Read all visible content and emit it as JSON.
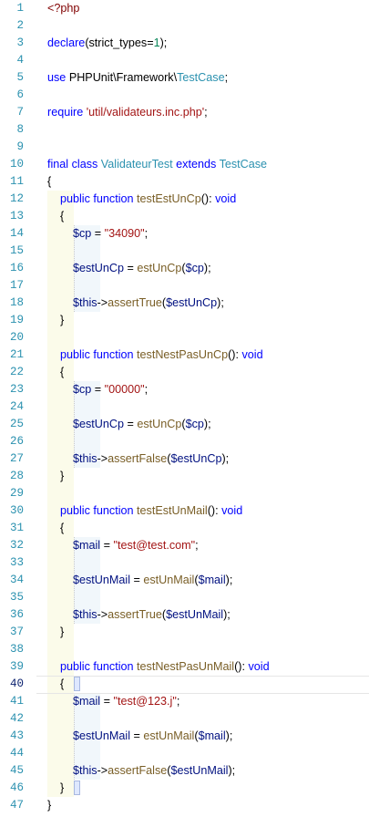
{
  "editor": {
    "language": "php",
    "active_line": 40,
    "colors": {
      "line_number": "#2b91af",
      "keyword": "#0000ff",
      "class_name": "#2b91af",
      "string": "#a31515",
      "variable": "#001080",
      "function": "#795e26",
      "number": "#098658",
      "php_tag": "#800000",
      "indent_guide_1": "#fbfbea",
      "indent_guide_2": "#f1f7fb"
    },
    "lines": [
      {
        "n": "1",
        "tokens": [
          {
            "t": "<?php",
            "c": "tag"
          }
        ]
      },
      {
        "n": "2",
        "tokens": []
      },
      {
        "n": "3",
        "tokens": [
          {
            "t": "declare",
            "c": "kw"
          },
          {
            "t": "(strict_types=",
            "c": "txt"
          },
          {
            "t": "1",
            "c": "num"
          },
          {
            "t": ");",
            "c": "txt"
          }
        ]
      },
      {
        "n": "4",
        "tokens": []
      },
      {
        "n": "5",
        "tokens": [
          {
            "t": "use ",
            "c": "kw"
          },
          {
            "t": "PHPUnit\\Framework\\",
            "c": "txt"
          },
          {
            "t": "TestCase",
            "c": "cls"
          },
          {
            "t": ";",
            "c": "txt"
          }
        ]
      },
      {
        "n": "6",
        "tokens": []
      },
      {
        "n": "7",
        "tokens": [
          {
            "t": "require ",
            "c": "kw"
          },
          {
            "t": "'util/validateurs.inc.php'",
            "c": "str"
          },
          {
            "t": ";",
            "c": "txt"
          }
        ]
      },
      {
        "n": "8",
        "tokens": []
      },
      {
        "n": "9",
        "tokens": []
      },
      {
        "n": "10",
        "tokens": [
          {
            "t": "final class ",
            "c": "kw"
          },
          {
            "t": "ValidateurTest ",
            "c": "cls"
          },
          {
            "t": "extends ",
            "c": "kw"
          },
          {
            "t": "TestCase",
            "c": "cls"
          }
        ]
      },
      {
        "n": "11",
        "tokens": [
          {
            "t": "{",
            "c": "txt"
          }
        ]
      },
      {
        "n": "12",
        "tokens": [
          {
            "t": "    ",
            "c": "txt"
          },
          {
            "t": "public function ",
            "c": "kw"
          },
          {
            "t": "testEstUnCp",
            "c": "fn"
          },
          {
            "t": "(): ",
            "c": "txt"
          },
          {
            "t": "void",
            "c": "kw"
          }
        ]
      },
      {
        "n": "13",
        "tokens": [
          {
            "t": "    {",
            "c": "txt"
          }
        ]
      },
      {
        "n": "14",
        "tokens": [
          {
            "t": "        ",
            "c": "txt"
          },
          {
            "t": "$cp",
            "c": "var"
          },
          {
            "t": " = ",
            "c": "txt"
          },
          {
            "t": "\"34090\"",
            "c": "str"
          },
          {
            "t": ";",
            "c": "txt"
          }
        ]
      },
      {
        "n": "15",
        "tokens": []
      },
      {
        "n": "16",
        "tokens": [
          {
            "t": "        ",
            "c": "txt"
          },
          {
            "t": "$estUnCp",
            "c": "var"
          },
          {
            "t": " = ",
            "c": "txt"
          },
          {
            "t": "estUnCp",
            "c": "fn"
          },
          {
            "t": "(",
            "c": "txt"
          },
          {
            "t": "$cp",
            "c": "var"
          },
          {
            "t": ");",
            "c": "txt"
          }
        ]
      },
      {
        "n": "17",
        "tokens": []
      },
      {
        "n": "18",
        "tokens": [
          {
            "t": "        ",
            "c": "txt"
          },
          {
            "t": "$this",
            "c": "var"
          },
          {
            "t": "->",
            "c": "txt"
          },
          {
            "t": "assertTrue",
            "c": "fn"
          },
          {
            "t": "(",
            "c": "txt"
          },
          {
            "t": "$estUnCp",
            "c": "var"
          },
          {
            "t": ");",
            "c": "txt"
          }
        ]
      },
      {
        "n": "19",
        "tokens": [
          {
            "t": "    }",
            "c": "txt"
          }
        ]
      },
      {
        "n": "20",
        "tokens": []
      },
      {
        "n": "21",
        "tokens": [
          {
            "t": "    ",
            "c": "txt"
          },
          {
            "t": "public function ",
            "c": "kw"
          },
          {
            "t": "testNestPasUnCp",
            "c": "fn"
          },
          {
            "t": "(): ",
            "c": "txt"
          },
          {
            "t": "void",
            "c": "kw"
          }
        ]
      },
      {
        "n": "22",
        "tokens": [
          {
            "t": "    {",
            "c": "txt"
          }
        ]
      },
      {
        "n": "23",
        "tokens": [
          {
            "t": "        ",
            "c": "txt"
          },
          {
            "t": "$cp",
            "c": "var"
          },
          {
            "t": " = ",
            "c": "txt"
          },
          {
            "t": "\"00000\"",
            "c": "str"
          },
          {
            "t": ";",
            "c": "txt"
          }
        ]
      },
      {
        "n": "24",
        "tokens": []
      },
      {
        "n": "25",
        "tokens": [
          {
            "t": "        ",
            "c": "txt"
          },
          {
            "t": "$estUnCp",
            "c": "var"
          },
          {
            "t": " = ",
            "c": "txt"
          },
          {
            "t": "estUnCp",
            "c": "fn"
          },
          {
            "t": "(",
            "c": "txt"
          },
          {
            "t": "$cp",
            "c": "var"
          },
          {
            "t": ");",
            "c": "txt"
          }
        ]
      },
      {
        "n": "26",
        "tokens": []
      },
      {
        "n": "27",
        "tokens": [
          {
            "t": "        ",
            "c": "txt"
          },
          {
            "t": "$this",
            "c": "var"
          },
          {
            "t": "->",
            "c": "txt"
          },
          {
            "t": "assertFalse",
            "c": "fn"
          },
          {
            "t": "(",
            "c": "txt"
          },
          {
            "t": "$estUnCp",
            "c": "var"
          },
          {
            "t": ");",
            "c": "txt"
          }
        ]
      },
      {
        "n": "28",
        "tokens": [
          {
            "t": "    }",
            "c": "txt"
          }
        ]
      },
      {
        "n": "29",
        "tokens": []
      },
      {
        "n": "30",
        "tokens": [
          {
            "t": "    ",
            "c": "txt"
          },
          {
            "t": "public function ",
            "c": "kw"
          },
          {
            "t": "testEstUnMail",
            "c": "fn"
          },
          {
            "t": "(): ",
            "c": "txt"
          },
          {
            "t": "void",
            "c": "kw"
          }
        ]
      },
      {
        "n": "31",
        "tokens": [
          {
            "t": "    {",
            "c": "txt"
          }
        ]
      },
      {
        "n": "32",
        "tokens": [
          {
            "t": "        ",
            "c": "txt"
          },
          {
            "t": "$mail",
            "c": "var"
          },
          {
            "t": " = ",
            "c": "txt"
          },
          {
            "t": "\"test@test.com\"",
            "c": "str"
          },
          {
            "t": ";",
            "c": "txt"
          }
        ]
      },
      {
        "n": "33",
        "tokens": []
      },
      {
        "n": "34",
        "tokens": [
          {
            "t": "        ",
            "c": "txt"
          },
          {
            "t": "$estUnMail",
            "c": "var"
          },
          {
            "t": " = ",
            "c": "txt"
          },
          {
            "t": "estUnMail",
            "c": "fn"
          },
          {
            "t": "(",
            "c": "txt"
          },
          {
            "t": "$mail",
            "c": "var"
          },
          {
            "t": ");",
            "c": "txt"
          }
        ]
      },
      {
        "n": "35",
        "tokens": []
      },
      {
        "n": "36",
        "tokens": [
          {
            "t": "        ",
            "c": "txt"
          },
          {
            "t": "$this",
            "c": "var"
          },
          {
            "t": "->",
            "c": "txt"
          },
          {
            "t": "assertTrue",
            "c": "fn"
          },
          {
            "t": "(",
            "c": "txt"
          },
          {
            "t": "$estUnMail",
            "c": "var"
          },
          {
            "t": ");",
            "c": "txt"
          }
        ]
      },
      {
        "n": "37",
        "tokens": [
          {
            "t": "    }",
            "c": "txt"
          }
        ]
      },
      {
        "n": "38",
        "tokens": []
      },
      {
        "n": "39",
        "tokens": [
          {
            "t": "    ",
            "c": "txt"
          },
          {
            "t": "public function ",
            "c": "kw"
          },
          {
            "t": "testNestPasUnMail",
            "c": "fn"
          },
          {
            "t": "(): ",
            "c": "txt"
          },
          {
            "t": "void",
            "c": "kw"
          }
        ]
      },
      {
        "n": "40",
        "tokens": [
          {
            "t": "    {",
            "c": "txt"
          }
        ]
      },
      {
        "n": "41",
        "tokens": [
          {
            "t": "        ",
            "c": "txt"
          },
          {
            "t": "$mail",
            "c": "var"
          },
          {
            "t": " = ",
            "c": "txt"
          },
          {
            "t": "\"test@123.j\"",
            "c": "str"
          },
          {
            "t": ";",
            "c": "txt"
          }
        ]
      },
      {
        "n": "42",
        "tokens": []
      },
      {
        "n": "43",
        "tokens": [
          {
            "t": "        ",
            "c": "txt"
          },
          {
            "t": "$estUnMail",
            "c": "var"
          },
          {
            "t": " = ",
            "c": "txt"
          },
          {
            "t": "estUnMail",
            "c": "fn"
          },
          {
            "t": "(",
            "c": "txt"
          },
          {
            "t": "$mail",
            "c": "var"
          },
          {
            "t": ");",
            "c": "txt"
          }
        ]
      },
      {
        "n": "44",
        "tokens": []
      },
      {
        "n": "45",
        "tokens": [
          {
            "t": "        ",
            "c": "txt"
          },
          {
            "t": "$this",
            "c": "var"
          },
          {
            "t": "->",
            "c": "txt"
          },
          {
            "t": "assertFalse",
            "c": "fn"
          },
          {
            "t": "(",
            "c": "txt"
          },
          {
            "t": "$estUnMail",
            "c": "var"
          },
          {
            "t": ");",
            "c": "txt"
          }
        ]
      },
      {
        "n": "46",
        "tokens": [
          {
            "t": "    }",
            "c": "txt"
          }
        ]
      },
      {
        "n": "47",
        "tokens": [
          {
            "t": "}",
            "c": "txt"
          }
        ]
      }
    ]
  }
}
